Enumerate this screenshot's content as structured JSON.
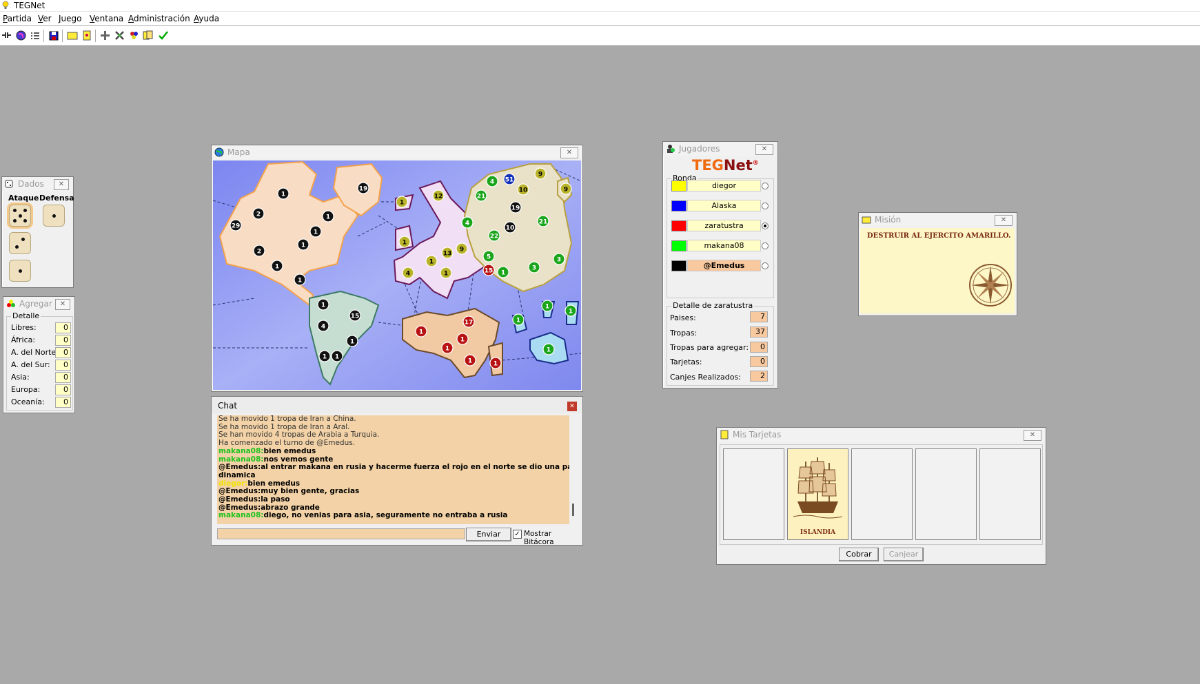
{
  "app": {
    "title": "TEGNet"
  },
  "menu": [
    {
      "key": "P",
      "rest": "artida"
    },
    {
      "key": "V",
      "rest": "er"
    },
    {
      "key": "J",
      "rest": "uego"
    },
    {
      "key": "V",
      "rest": "entana"
    },
    {
      "key": "A",
      "rest": "dministración"
    },
    {
      "key": "A",
      "rest": "yuda"
    }
  ],
  "toolbar_icons": [
    "connect-icon",
    "globe-icon",
    "list-icon",
    "save-icon",
    "mission-icon",
    "cards-icon",
    "add-troops-icon",
    "attack-icon",
    "regroup-icon",
    "exchange-icon",
    "end-turn-icon"
  ],
  "dados": {
    "title": "Dados",
    "attack_label": "Ataque",
    "defense_label": "Defensa",
    "attack_dice": [
      5,
      2,
      1
    ],
    "defense_dice": [
      1
    ]
  },
  "agregar": {
    "title": "Agregar",
    "group_label": "Detalle",
    "rows": [
      {
        "label": "Libres:",
        "value": "0"
      },
      {
        "label": "África:",
        "value": "0"
      },
      {
        "label": "A. del Norte:",
        "value": "0"
      },
      {
        "label": "A. del Sur:",
        "value": "0"
      },
      {
        "label": "Asia:",
        "value": "0"
      },
      {
        "label": "Europa:",
        "value": "0"
      },
      {
        "label": "Oceanía:",
        "value": "0"
      }
    ]
  },
  "mapa": {
    "title": "Mapa",
    "armies": [
      {
        "n": "29",
        "c": "black"
      },
      {
        "n": "2",
        "c": "black"
      },
      {
        "n": "1",
        "c": "black"
      },
      {
        "n": "19",
        "c": "black"
      },
      {
        "n": "1",
        "c": "black"
      },
      {
        "n": "1",
        "c": "black"
      },
      {
        "n": "1",
        "c": "black"
      },
      {
        "n": "2",
        "c": "black"
      },
      {
        "n": "1",
        "c": "black"
      },
      {
        "n": "1",
        "c": "black"
      },
      {
        "n": "1",
        "c": "black"
      },
      {
        "n": "15",
        "c": "black"
      },
      {
        "n": "4",
        "c": "black"
      },
      {
        "n": "1",
        "c": "black"
      },
      {
        "n": "1",
        "c": "black"
      },
      {
        "n": "1",
        "c": "black"
      },
      {
        "n": "1",
        "c": "yellow"
      },
      {
        "n": "12",
        "c": "yellow"
      },
      {
        "n": "1",
        "c": "yellow"
      },
      {
        "n": "1",
        "c": "yellow"
      },
      {
        "n": "13",
        "c": "yellow"
      },
      {
        "n": "9",
        "c": "yellow"
      },
      {
        "n": "4",
        "c": "yellow"
      },
      {
        "n": "1",
        "c": "yellow"
      },
      {
        "n": "4",
        "c": "green"
      },
      {
        "n": "51",
        "c": "blue"
      },
      {
        "n": "10",
        "c": "yellow"
      },
      {
        "n": "9",
        "c": "yellow"
      },
      {
        "n": "9",
        "c": "yellow"
      },
      {
        "n": "21",
        "c": "green"
      },
      {
        "n": "19",
        "c": "black"
      },
      {
        "n": "21",
        "c": "green"
      },
      {
        "n": "4",
        "c": "green"
      },
      {
        "n": "10",
        "c": "black"
      },
      {
        "n": "22",
        "c": "green"
      },
      {
        "n": "5",
        "c": "green"
      },
      {
        "n": "15",
        "c": "red"
      },
      {
        "n": "1",
        "c": "green"
      },
      {
        "n": "3",
        "c": "green"
      },
      {
        "n": "3",
        "c": "green"
      },
      {
        "n": "17",
        "c": "red"
      },
      {
        "n": "1",
        "c": "red"
      },
      {
        "n": "1",
        "c": "red"
      },
      {
        "n": "1",
        "c": "red"
      },
      {
        "n": "1",
        "c": "red"
      },
      {
        "n": "1",
        "c": "red"
      },
      {
        "n": "1",
        "c": "green"
      },
      {
        "n": "1",
        "c": "green"
      },
      {
        "n": "1",
        "c": "green"
      },
      {
        "n": "1",
        "c": "green"
      }
    ]
  },
  "chat": {
    "title": "Chat",
    "lines": [
      {
        "who": "",
        "text": "Se ha movido 1 tropa de Iran a China.",
        "style": "sys"
      },
      {
        "who": "",
        "text": "Se ha movido 1 tropa de Iran a Aral.",
        "style": "sys"
      },
      {
        "who": "",
        "text": "Se han movido 4 tropas de Arabia a Turquia.",
        "style": "sys"
      },
      {
        "who": "",
        "text": "Ha comenzado el turno de @Emedus.",
        "style": "sys"
      },
      {
        "who": "makana08:",
        "text": "bien emedus",
        "style": "green"
      },
      {
        "who": "makana08:",
        "text": "nos vemos gente",
        "style": "green"
      },
      {
        "who": "@Emedus:",
        "text": "al entrar makana en rusia y hacerme fuerza el rojo en el norte se dio una partida mas",
        "style": "black"
      },
      {
        "who": "",
        "text": "dinamica",
        "style": "black"
      },
      {
        "who": "diegor:",
        "text": "bien emedus",
        "style": "yellow"
      },
      {
        "who": "@Emedus:",
        "text": "muy bien gente, gracias",
        "style": "black"
      },
      {
        "who": "@Emedus:",
        "text": "la paso",
        "style": "black"
      },
      {
        "who": "@Emedus:",
        "text": "abrazo grande",
        "style": "black"
      },
      {
        "who": "makana08:",
        "text": "diego, no venias para asia, seguramente no entraba a rusia",
        "style": "green"
      }
    ],
    "input_value": "",
    "send_label": "Enviar",
    "show_log_label": "Mostrar Bitácora",
    "show_log_checked": true
  },
  "jugadores": {
    "title": "Jugadores",
    "logo_a": "TEG",
    "logo_b": "Net",
    "logo_mark": "®",
    "round_label": "Ronda",
    "players": [
      {
        "name": "diegor",
        "color": "#ffff00",
        "selected": false
      },
      {
        "name": "Alaska",
        "color": "#0000ff",
        "selected": false
      },
      {
        "name": "zaratustra",
        "color": "#ff0000",
        "selected": true
      },
      {
        "name": "makana08",
        "color": "#00ff00",
        "selected": false
      },
      {
        "name": "@Emedus",
        "color": "#000000",
        "selected": false
      }
    ],
    "detail_label": "Detalle de zaratustra",
    "details": [
      {
        "label": "Paises:",
        "value": "7"
      },
      {
        "label": "Tropas:",
        "value": "37"
      },
      {
        "label": "Tropas para agregar:",
        "value": "0"
      },
      {
        "label": "Tarjetas:",
        "value": "0"
      },
      {
        "label": "Canjes Realizados:",
        "value": "2"
      }
    ]
  },
  "mision": {
    "title": "Misión",
    "text": "DESTRUIR AL EJERCITO AMARILLO."
  },
  "tarjetas": {
    "title": "Mis Tarjetas",
    "cards": [
      "",
      "ISLANDIA",
      "",
      "",
      ""
    ],
    "collect_label": "Cobrar",
    "exchange_label": "Canjear"
  },
  "colors": {
    "background": "#a9a9a9",
    "panel": "#f0f0f0",
    "field": "#ffffc6",
    "chat_bg": "#f2d2a6"
  }
}
